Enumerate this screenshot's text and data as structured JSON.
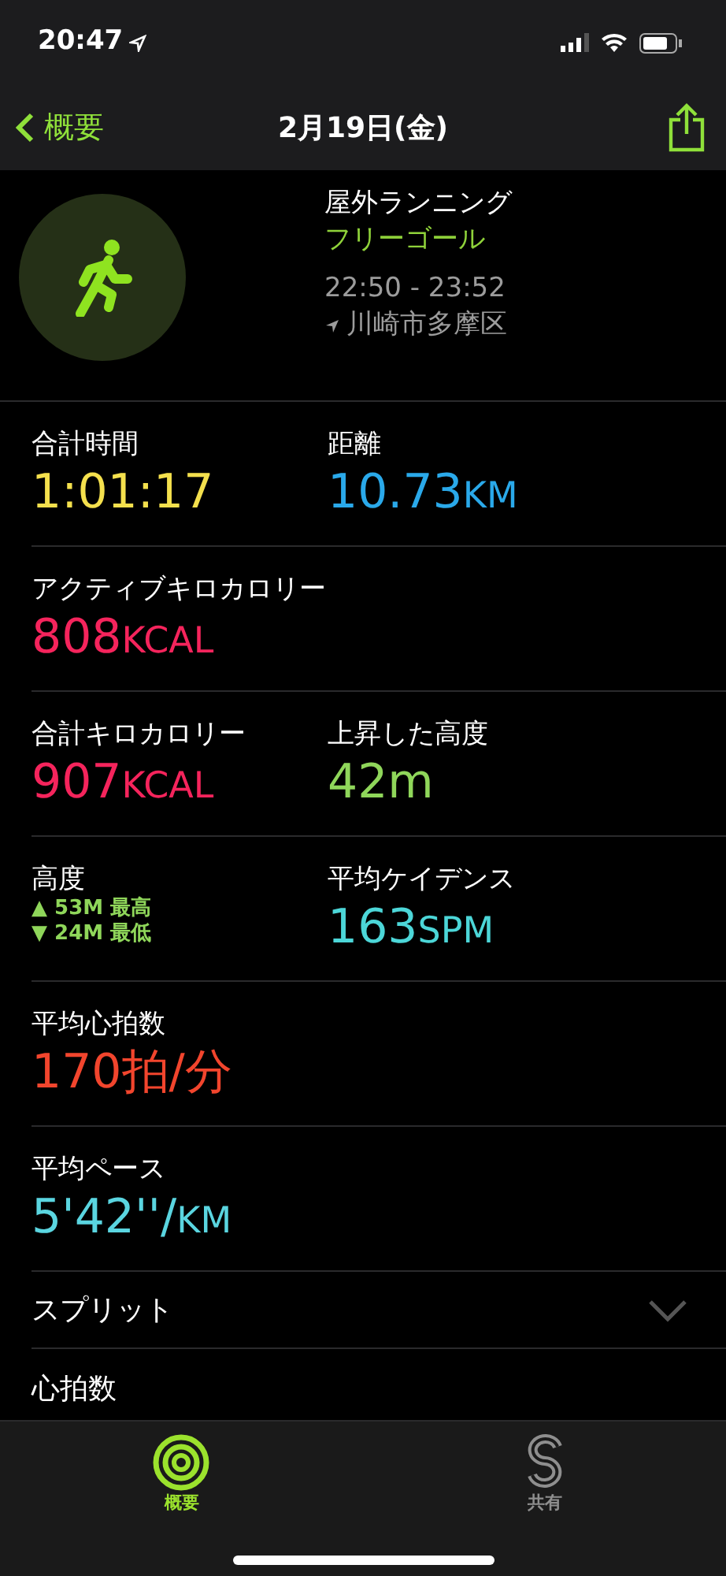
{
  "status_bar": {
    "time": "20:47"
  },
  "nav": {
    "back": "概要",
    "title": "2月19日(金)"
  },
  "workout": {
    "type": "屋外ランニング",
    "goal": "フリーゴール",
    "time_range": "22:50 - 23:52",
    "location": "川崎市多摩区"
  },
  "metric_rows": [
    {
      "cells": [
        {
          "kind": "value",
          "label": "合計時間",
          "value": "1:01:17",
          "color": "#f4e04d"
        },
        {
          "kind": "value",
          "label": "距離",
          "value": "10.73",
          "unit": "KM",
          "color": "#2aa9ea"
        }
      ]
    },
    {
      "cells": [
        {
          "kind": "value",
          "label": "アクティブキロカロリー",
          "value": "808",
          "unit": "KCAL",
          "color": "#f5245c"
        }
      ]
    },
    {
      "cells": [
        {
          "kind": "value",
          "label": "合計キロカロリー",
          "value": "907",
          "unit": "KCAL",
          "color": "#f5245c"
        },
        {
          "kind": "value",
          "label": "上昇した高度",
          "value": "42m",
          "color": "#8fd65a"
        }
      ]
    },
    {
      "cells": [
        {
          "kind": "range",
          "label": "高度",
          "lines": [
            "▲ 53M 最高",
            "▼ 24M 最低"
          ],
          "color": "#8fd65a"
        },
        {
          "kind": "value",
          "label": "平均ケイデンス",
          "value": "163",
          "unit": "SPM",
          "color": "#4cd6d8"
        }
      ]
    },
    {
      "cells": [
        {
          "kind": "value",
          "label": "平均心拍数",
          "value": "170拍/分",
          "color": "#f2452d"
        }
      ]
    },
    {
      "cells": [
        {
          "kind": "value",
          "label": "平均ペース",
          "value": "5'42''/",
          "unit": "KM",
          "color": "#5ad5e0"
        }
      ]
    }
  ],
  "splits": {
    "label": "スプリット",
    "expanded": false
  },
  "heart_rate": {
    "label": "心拍数"
  },
  "tabs": [
    {
      "label": "概要",
      "selected": true,
      "kind": "rings"
    },
    {
      "label": "共有",
      "selected": false,
      "kind": "share"
    }
  ]
}
